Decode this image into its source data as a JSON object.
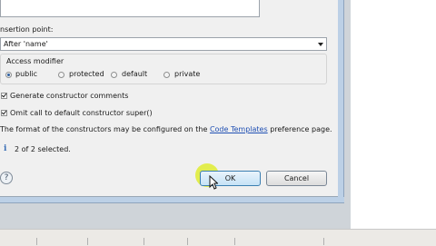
{
  "dialog": {
    "insertion_point_label": "nsertion point:",
    "insertion_point_value": "After 'name'",
    "access_modifier_label": "Access modifier",
    "access_options": [
      {
        "label": "public",
        "selected": true
      },
      {
        "label": "protected",
        "selected": false
      },
      {
        "label": "default",
        "selected": false
      },
      {
        "label": "private",
        "selected": false
      }
    ],
    "generate_comments": {
      "label": "Generate constructor comments",
      "checked": true
    },
    "omit_super": {
      "label": "Omit call to default constructor super()",
      "checked": true
    },
    "format_text_before": "The format of the constructors may be configured on the",
    "format_link": "Code Templates",
    "format_text_after": "preference page.",
    "status_text": "2 of 2 selected.",
    "ok_label": "OK",
    "cancel_label": "Cancel",
    "help_glyph": "?"
  },
  "icons": {
    "info": "info-icon",
    "help": "help-icon",
    "cursor": "mouse-pointer-icon",
    "dropdown": "chevron-down-icon"
  },
  "colors": {
    "dialog_bg": "#f0f0f0",
    "link": "#1f4fb3",
    "ok_button": "#c5e2f6",
    "cursor_highlight": "#deec18"
  }
}
